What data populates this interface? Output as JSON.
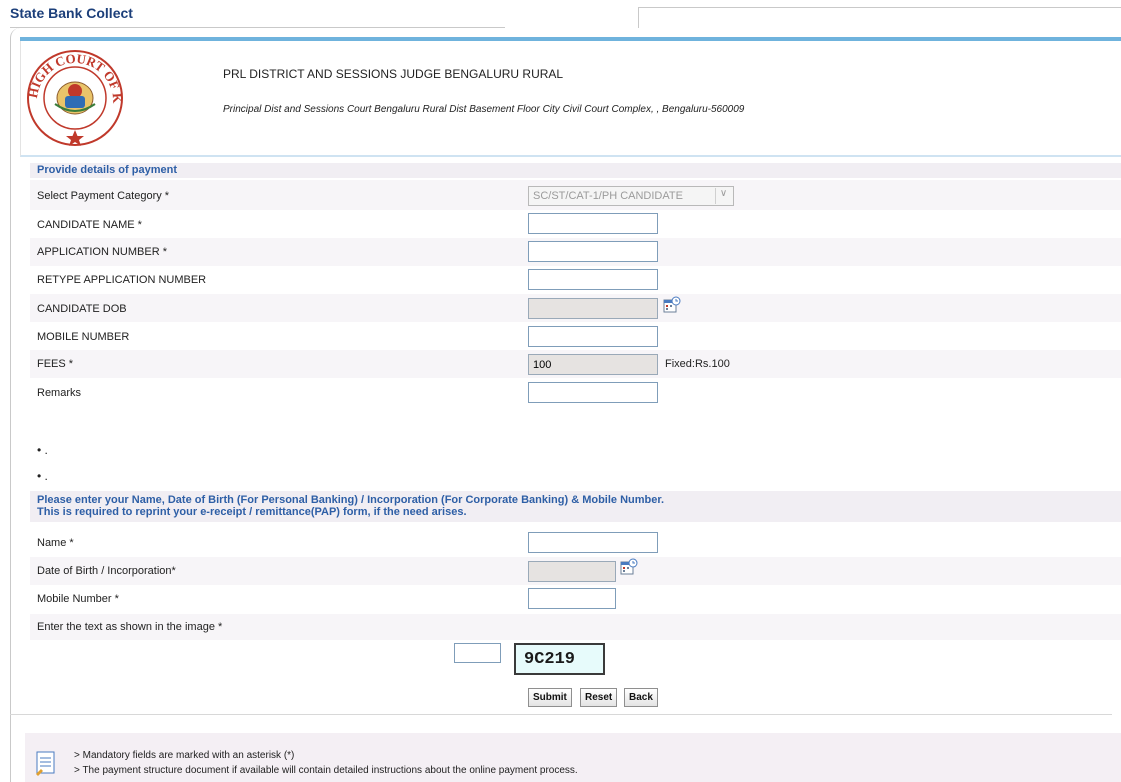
{
  "app": {
    "title": "State Bank Collect"
  },
  "header": {
    "court_name": "PRL DISTRICT AND SESSIONS JUDGE BENGALURU RURAL",
    "court_address": "Principal Dist and Sessions Court Bengaluru Rural Dist Basement Floor City Civil Court Complex, , Bengaluru-560009",
    "logo_text": "HIGH COURT OF KARNATAKA"
  },
  "payment": {
    "section_title": "Provide details of payment",
    "category": {
      "label": "Select Payment Category *",
      "value": "SC/ST/CAT-1/PH CANDIDATE"
    },
    "candidate_name": {
      "label": "CANDIDATE NAME *",
      "value": ""
    },
    "application_number": {
      "label": "APPLICATION NUMBER *",
      "value": ""
    },
    "retype_application_number": {
      "label": "RETYPE APPLICATION NUMBER",
      "value": ""
    },
    "candidate_dob": {
      "label": "CANDIDATE DOB",
      "value": ""
    },
    "mobile_number": {
      "label": "MOBILE NUMBER",
      "value": ""
    },
    "fees": {
      "label": "FEES *",
      "value": "100",
      "note": "Fixed:Rs.100"
    },
    "remarks": {
      "label": "Remarks",
      "value": ""
    },
    "bullets": [
      "• .",
      "• ."
    ]
  },
  "personal": {
    "section_title_line1": "Please enter your Name, Date of Birth (For Personal Banking) / Incorporation (For Corporate Banking)  & Mobile Number.",
    "section_title_line2": "This is required to reprint your e-receipt / remittance(PAP) form, if the need arises.",
    "name": {
      "label": "Name *",
      "value": ""
    },
    "dob": {
      "label": "Date of Birth / Incorporation*",
      "value": ""
    },
    "mobile": {
      "label": "Mobile Number *",
      "value": ""
    },
    "captcha_label": "Enter the text as shown in the image *",
    "captcha_text": "9C219",
    "captcha_value": ""
  },
  "buttons": {
    "submit": "Submit",
    "reset": "Reset",
    "back": "Back"
  },
  "notes": [
    "> Mandatory fields are marked with an asterisk (*)",
    "> The payment structure document if available will contain detailed instructions about the online payment process."
  ],
  "icons": {
    "calendar": "calendar-icon",
    "notice": "notepad-icon"
  },
  "colors": {
    "accent": "#1c3f7a",
    "section_text": "#2e5fa6",
    "section_bg": "#f1eef3",
    "header_strip": "#6fb3dd"
  }
}
